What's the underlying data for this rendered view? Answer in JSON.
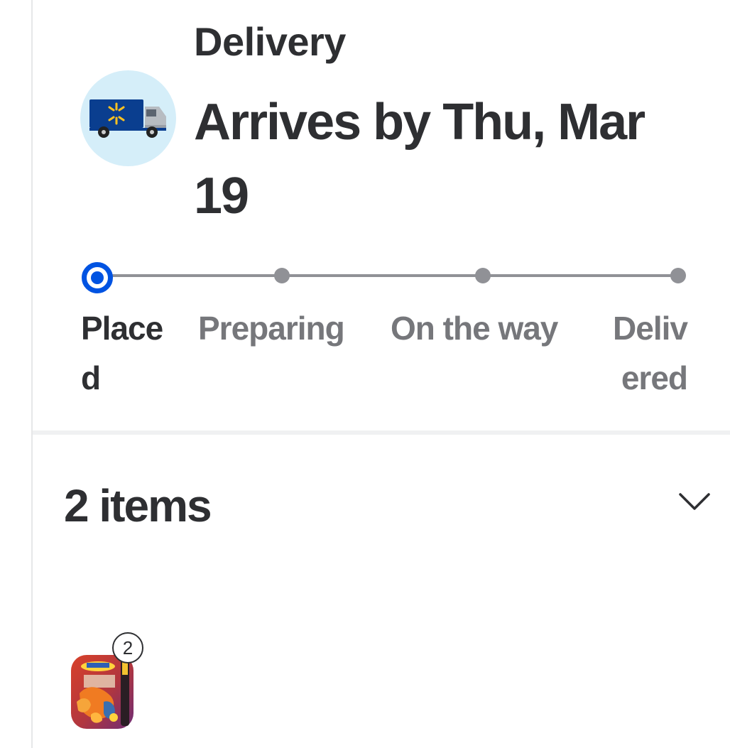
{
  "delivery": {
    "section_label": "Delivery",
    "arrival_text": "Arrives by Thu, Mar 19",
    "truck_icon": "walmart-delivery-truck-icon"
  },
  "tracker": {
    "current_step": 0,
    "accent_color": "#0053e2",
    "steps": [
      {
        "label": "Place\nd",
        "state": "current"
      },
      {
        "label": "Preparing",
        "state": "upcoming"
      },
      {
        "label": "On the way",
        "state": "upcoming"
      },
      {
        "label": "Deliv\nered",
        "state": "upcoming"
      }
    ]
  },
  "items": {
    "header": "2 items",
    "toggle_icon": "chevron-down-icon",
    "products": [
      {
        "quantity": "2",
        "image": "pokemon-tin-product-thumbnail"
      }
    ]
  }
}
